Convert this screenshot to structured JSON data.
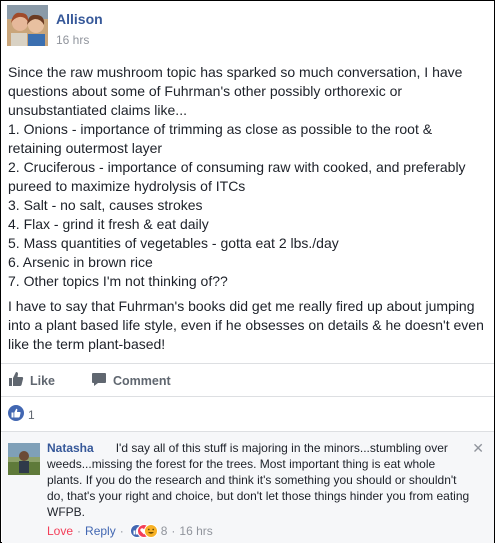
{
  "post": {
    "author": "Allison",
    "timestamp": "16 hrs",
    "intro": "Since the raw mushroom topic has sparked so much conversation, I have questions about some of Fuhrman's other possibly orthorexic or unsubstantiated claims like...",
    "list": [
      "1. Onions - importance of trimming as close as possible to the root & retaining outermost layer",
      "2. Cruciferous - importance of consuming raw with cooked, and preferably pureed to maximize hydrolysis of ITCs",
      "3. Salt - no salt, causes strokes",
      "4. Flax - grind it fresh & eat daily",
      "5. Mass quantities of vegetables - gotta eat 2 lbs./day",
      "6. Arsenic in brown rice",
      "7. Other topics I'm not thinking of??"
    ],
    "closing": "I have to say that Fuhrman's books did get me really fired up about jumping into a plant based life style, even if he obsesses on details & he doesn't even like the term plant-based!"
  },
  "actions": {
    "like_label": "Like",
    "comment_label": "Comment"
  },
  "reactions": {
    "count": "1",
    "like_color": "#4267b2"
  },
  "comment": {
    "author": "Natasha",
    "text": "I'd say all of this stuff is majoring in the minors...stumbling over weeds...missing the forest for the trees. Most important thing is eat whole plants. If you do the research and think it's something you should or shouldn't do, that's your right and choice, but don't let those things hinder you from eating WFPB.",
    "love_label": "Love",
    "reply_label": "Reply",
    "reaction_count": "8",
    "timestamp": "16 hrs",
    "close_glyph": "✕",
    "separator": "·"
  }
}
